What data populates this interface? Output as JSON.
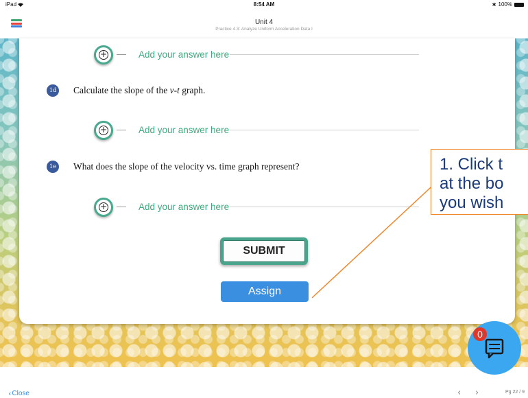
{
  "status_bar": {
    "device": "iPad",
    "time": "8:54 AM",
    "battery": "100%"
  },
  "header": {
    "title": "Unit 4",
    "subtitle": "Practice 4.3: Analyze Uniform Acceleration Data I"
  },
  "answers": [
    {
      "placeholder": "Add your answer here"
    },
    {
      "placeholder": "Add your answer here"
    },
    {
      "placeholder": "Add your answer here"
    }
  ],
  "questions": [
    {
      "badge": "1d",
      "text": "Calculate the slope of the v-t graph."
    },
    {
      "badge": "1e",
      "text": "What does the slope of the velocity vs. time graph represent?"
    }
  ],
  "buttons": {
    "submit": "SUBMIT",
    "assign": "Assign"
  },
  "callout": {
    "lines": [
      "1. Click t",
      "at the bo",
      "you wish"
    ]
  },
  "chat": {
    "badge_count": "0"
  },
  "bottom_bar": {
    "close": "Close",
    "page": "Pg 22 / 9"
  },
  "colors": {
    "accent_green": "#3daa7e",
    "assign_blue": "#3b8fe0",
    "callout_border": "#f0872b",
    "badge_red": "#e0372a"
  },
  "icons": [
    "wifi-icon",
    "bluetooth-icon",
    "battery-icon",
    "list-menu-icon",
    "add-circle-icon",
    "chat-icon",
    "chevron-left-icon",
    "chevron-right-icon"
  ]
}
